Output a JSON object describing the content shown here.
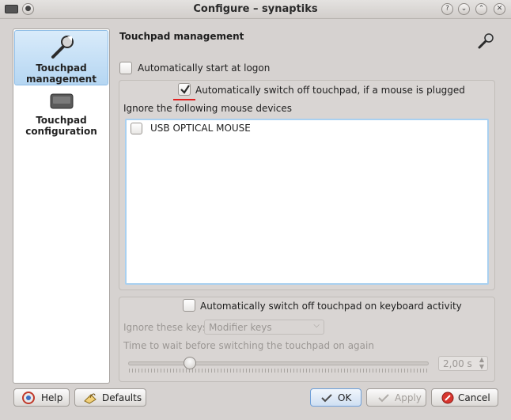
{
  "window": {
    "title": "Configure – synaptiks"
  },
  "titlebar_buttons": [
    "help-icon",
    "minimize-icon",
    "maximize-icon",
    "close-icon"
  ],
  "sidebar": {
    "items": [
      {
        "label": "Touchpad management",
        "icon": "wrench-icon",
        "selected": true
      },
      {
        "label": "Touchpad configuration",
        "icon": "touchpad-icon",
        "selected": false
      }
    ]
  },
  "page": {
    "title": "Touchpad management",
    "auto_start": {
      "label": "Automatically start at logon",
      "checked": false
    },
    "mouse_group": {
      "switch_off_mouse": {
        "label": "Automatically switch off touchpad, if a mouse is plugged",
        "checked": true
      },
      "ignore_label": "Ignore the following mouse devices",
      "devices": [
        {
          "label": "USB OPTICAL MOUSE",
          "checked": false
        }
      ]
    },
    "keyboard_group": {
      "switch_off_keyboard": {
        "label": "Automatically switch off touchpad on keyboard activity",
        "checked": false
      },
      "ignore_keys_label": "Ignore these keys",
      "ignore_keys_value": "Modifier keys",
      "wait_label": "Time to wait before switching the touchpad on again",
      "wait_value": "2,00 s",
      "slider_fraction": 0.2
    }
  },
  "buttons": {
    "help": "Help",
    "defaults": "Defaults",
    "ok": "OK",
    "apply": "Apply",
    "cancel": "Cancel"
  }
}
